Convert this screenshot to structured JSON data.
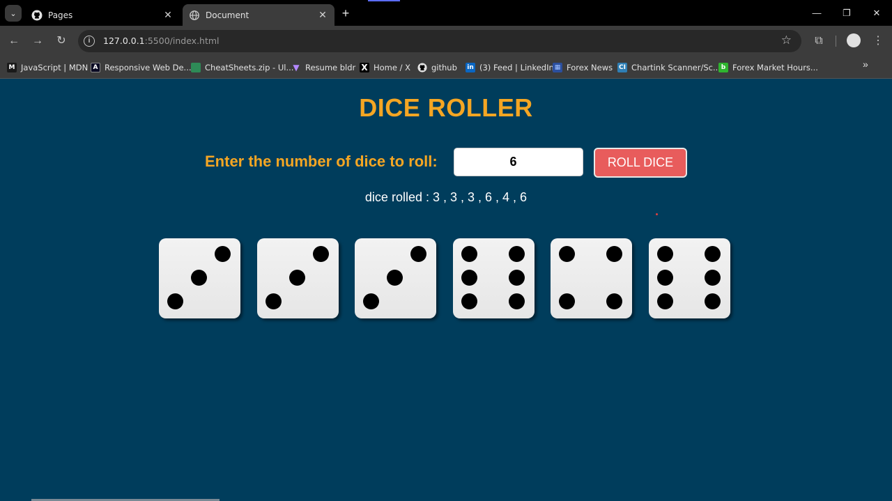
{
  "browser": {
    "tabs": [
      {
        "title": "Pages",
        "icon": "github-icon",
        "active": false
      },
      {
        "title": "Document",
        "icon": "globe-icon",
        "active": true
      }
    ],
    "new_tab": "+",
    "url_host": "127.0.0.1",
    "url_rest": ":5500/index.html",
    "bookmarks": [
      {
        "label": "JavaScript | MDN",
        "icon": "M",
        "color": "#1a1a1a"
      },
      {
        "label": "Responsive Web De...",
        "icon": "A",
        "color": "#0a0a23"
      },
      {
        "label": "CheatSheets.zip - Ul...",
        "icon": "▮",
        "color": "#2e8b57"
      },
      {
        "label": "Resume bldr",
        "icon": "▼",
        "color": "#7c4dff"
      },
      {
        "label": "Home / X",
        "icon": "X",
        "color": "#000000"
      },
      {
        "label": "github",
        "icon": "●",
        "color": "#ffffff"
      },
      {
        "label": "(3) Feed | LinkedIn",
        "icon": "in",
        "color": "#0a66c2"
      },
      {
        "label": "Forex News",
        "icon": "▦",
        "color": "#2b4f9e"
      },
      {
        "label": "Chartink Scanner/Sc...",
        "icon": "CI",
        "color": "#2f7fb5"
      },
      {
        "label": "Forex Market Hours...",
        "icon": "b",
        "color": "#2fb52f"
      }
    ]
  },
  "app": {
    "title": "DICE ROLLER",
    "prompt": "Enter the number of dice to roll:",
    "input_value": "6",
    "button_label": "ROLL DICE",
    "result_text": "dice rolled : 3 , 3 , 3 , 6 , 4 , 6",
    "dice": [
      3,
      3,
      3,
      6,
      4,
      6
    ]
  }
}
